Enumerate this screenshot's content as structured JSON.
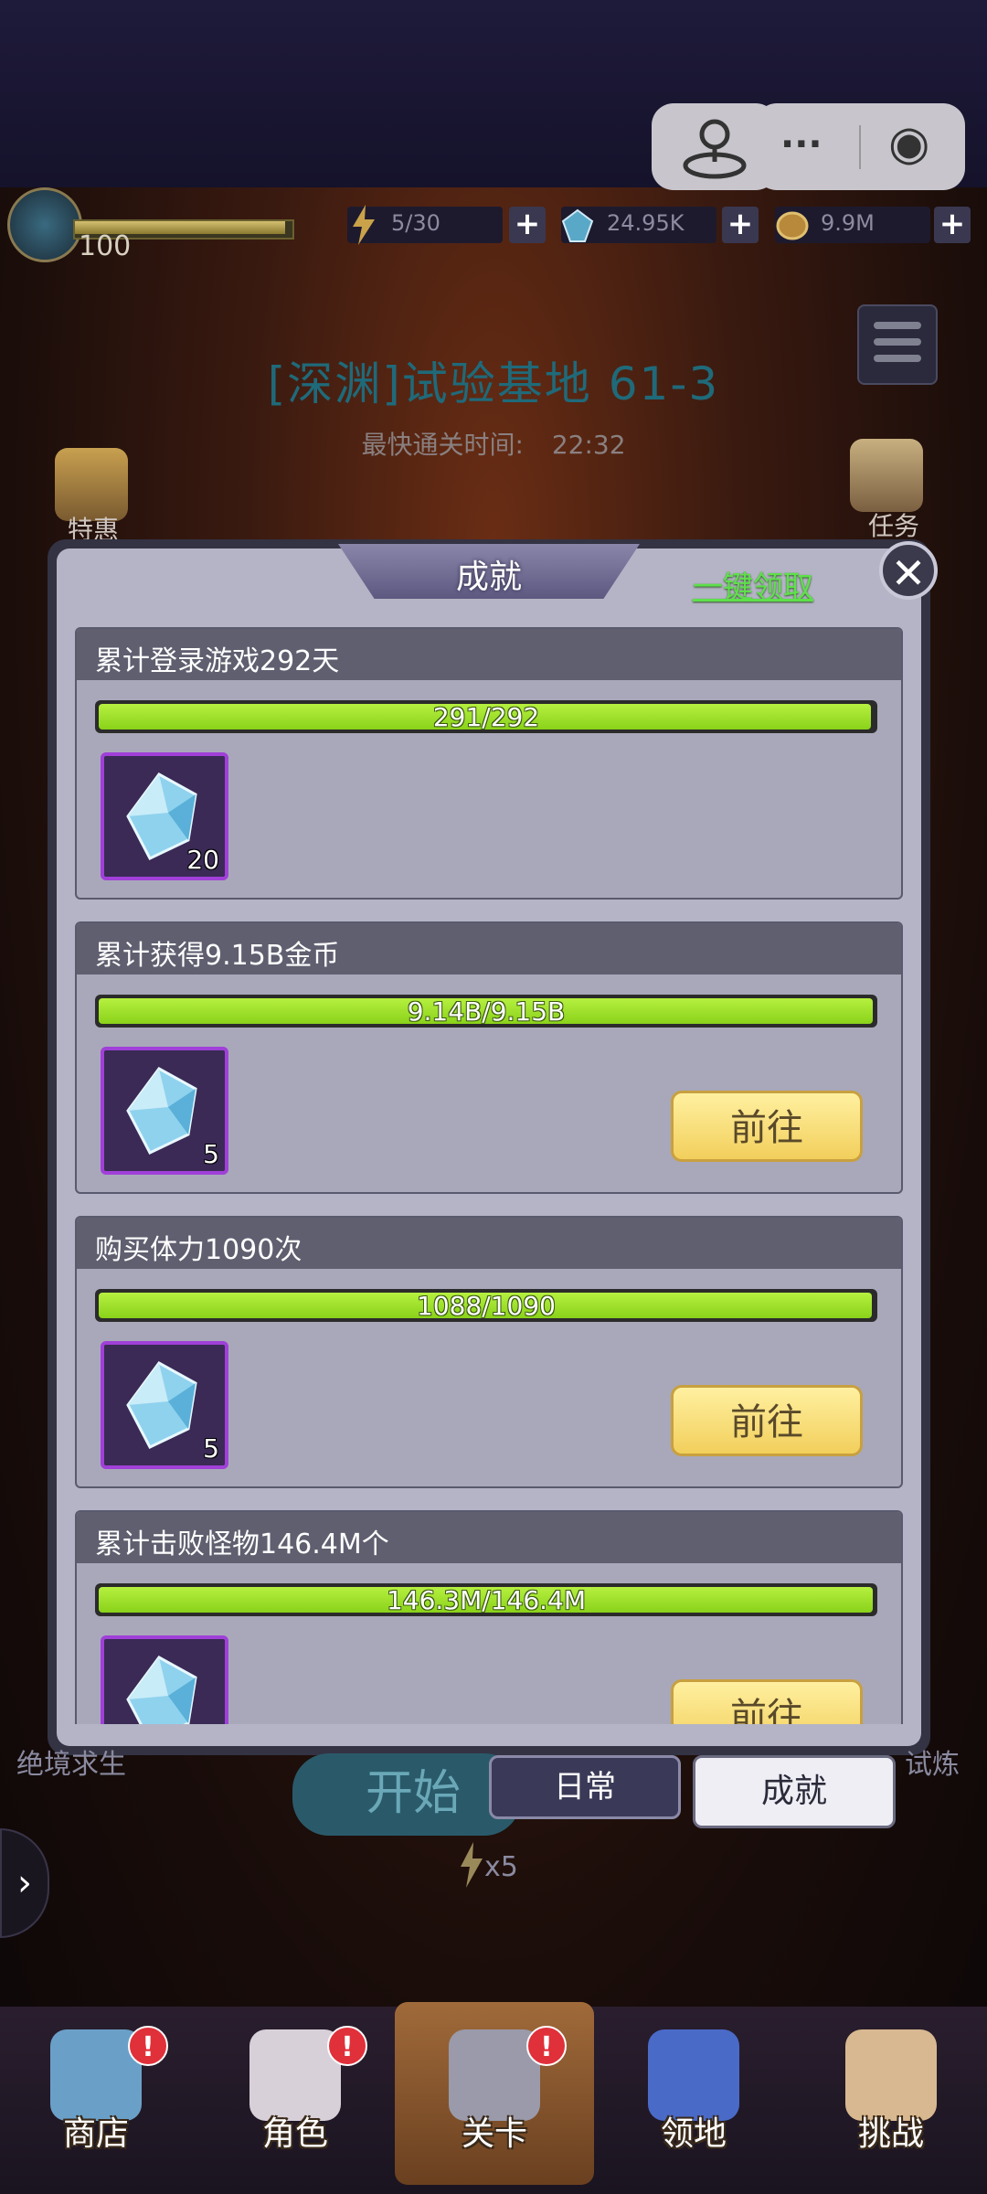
{
  "status_bar": {
    "level": "100",
    "stamina": "5/30",
    "gems": "24.95K",
    "gold": "9.9M",
    "plus": "+"
  },
  "capsule": {
    "more": "···",
    "record": "◉"
  },
  "stage": {
    "title": "[深渊]试验基地 61-3",
    "fastest_label": "最快通关时间:",
    "fastest_time": "22:32"
  },
  "side": {
    "deals": "特惠",
    "tasks": "任务",
    "left_bottom": "绝境求生",
    "right_bottom": "试炼"
  },
  "modal": {
    "title": "成就",
    "claim_all": "一键领取",
    "close": "✕",
    "go_label": "前往",
    "achievements": [
      {
        "title": "累计登录游戏292天",
        "progress_text": "291/292",
        "progress": 0.9966,
        "reward_count": "20",
        "reward_icon": "diamond-icon",
        "show_go": false
      },
      {
        "title": "累计获得9.15B金币",
        "progress_text": "9.14B/9.15B",
        "progress": 0.9989,
        "reward_count": "5",
        "reward_icon": "diamond-icon",
        "show_go": true
      },
      {
        "title": "购买体力1090次",
        "progress_text": "1088/1090",
        "progress": 0.9982,
        "reward_count": "5",
        "reward_icon": "diamond-icon",
        "show_go": true
      },
      {
        "title": "累计击败怪物146.4M个",
        "progress_text": "146.3M/146.4M",
        "progress": 0.9993,
        "reward_count": "",
        "reward_icon": "diamond-icon",
        "show_go": true
      }
    ]
  },
  "tabs": {
    "daily": "日常",
    "achievement": "成就",
    "start": "开始",
    "stamina_cost": "x5",
    "expand": "›"
  },
  "bottom_nav": [
    {
      "label": "商店",
      "badge": "!"
    },
    {
      "label": "角色",
      "badge": "!"
    },
    {
      "label": "关卡",
      "badge": "!"
    },
    {
      "label": "领地",
      "badge": ""
    },
    {
      "label": "挑战",
      "badge": ""
    }
  ],
  "colors": {
    "progress": "#9be22b",
    "go_button": "#f2cf5c",
    "item_border": "#a040d8",
    "claim_all": "#5ee04a"
  }
}
